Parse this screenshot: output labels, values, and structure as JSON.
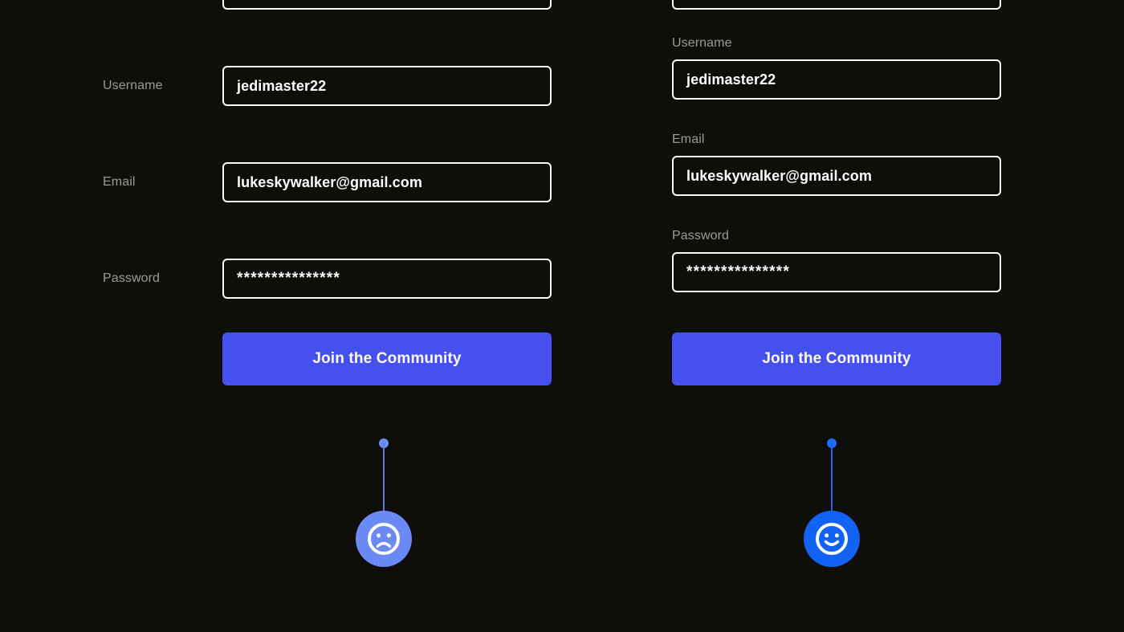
{
  "page": {
    "background_color": "#0f0e0b",
    "accent_button_color": "#4550ee",
    "label_color": "#9b9b96",
    "input_border_color": "#ffffff"
  },
  "variants": [
    {
      "id": "left-aligned-labels",
      "label_placement": "left",
      "fields": [
        {
          "label": "Username",
          "value": "jedimaster22",
          "type": "text"
        },
        {
          "label": "Email",
          "value": "lukeskywalker@gmail.com",
          "type": "email"
        },
        {
          "label": "Password",
          "value": "***************",
          "type": "password"
        }
      ],
      "submit_label": "Join the Community",
      "marker": {
        "sentiment": "negative",
        "icon": "frowning-face-icon",
        "circle_color": "#6b8af5",
        "dot_color": "#6f8ff2"
      }
    },
    {
      "id": "top-aligned-labels",
      "label_placement": "top",
      "fields": [
        {
          "label": "Username",
          "value": "jedimaster22",
          "type": "text"
        },
        {
          "label": "Email",
          "value": "lukeskywalker@gmail.com",
          "type": "email"
        },
        {
          "label": "Password",
          "value": "***************",
          "type": "password"
        }
      ],
      "submit_label": "Join the Community",
      "marker": {
        "sentiment": "positive",
        "icon": "smiling-face-icon",
        "circle_color": "#1263f5",
        "dot_color": "#1a6dff"
      }
    }
  ]
}
